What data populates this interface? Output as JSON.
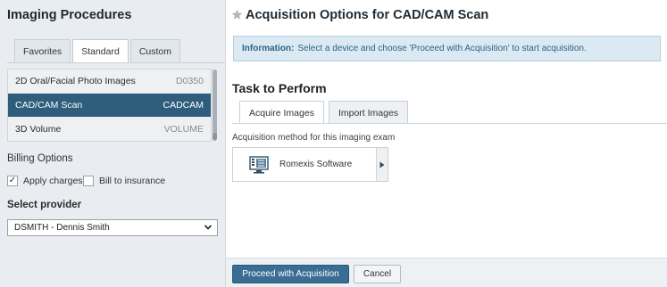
{
  "left": {
    "title": "Imaging Procedures",
    "tabs": [
      {
        "label": "Favorites"
      },
      {
        "label": "Standard"
      },
      {
        "label": "Custom"
      }
    ],
    "procedures": [
      {
        "name": "2D Oral/Facial Photo Images",
        "code": "D0350"
      },
      {
        "name": "CAD/CAM Scan",
        "code": "CADCAM"
      },
      {
        "name": "3D Volume",
        "code": "VOLUME"
      }
    ],
    "billing_title": "Billing Options",
    "apply_charges": {
      "label": "Apply charges",
      "checked": true
    },
    "bill_insurance": {
      "label": "Bill to insurance",
      "checked": false
    },
    "provider_title": "Select provider",
    "provider_value": "DSMITH - Dennis Smith"
  },
  "right": {
    "title": "Acquisition Options for CAD/CAM Scan",
    "info_label": "Information:",
    "info_text": "Select a device and choose 'Proceed with Acquisition' to start acquisition.",
    "task_title": "Task to Perform",
    "tabs": [
      {
        "label": "Acquire Images"
      },
      {
        "label": "Import Images"
      }
    ],
    "method_label": "Acquisition method for this imaging exam",
    "method_name": "Romexis Software"
  },
  "footer": {
    "proceed_label": "Proceed with Acquisition",
    "cancel_label": "Cancel"
  },
  "colors": {
    "selected_row": "#2f5d7c",
    "primary_button": "#3a6d94",
    "info_bg": "#dbe9f3"
  }
}
